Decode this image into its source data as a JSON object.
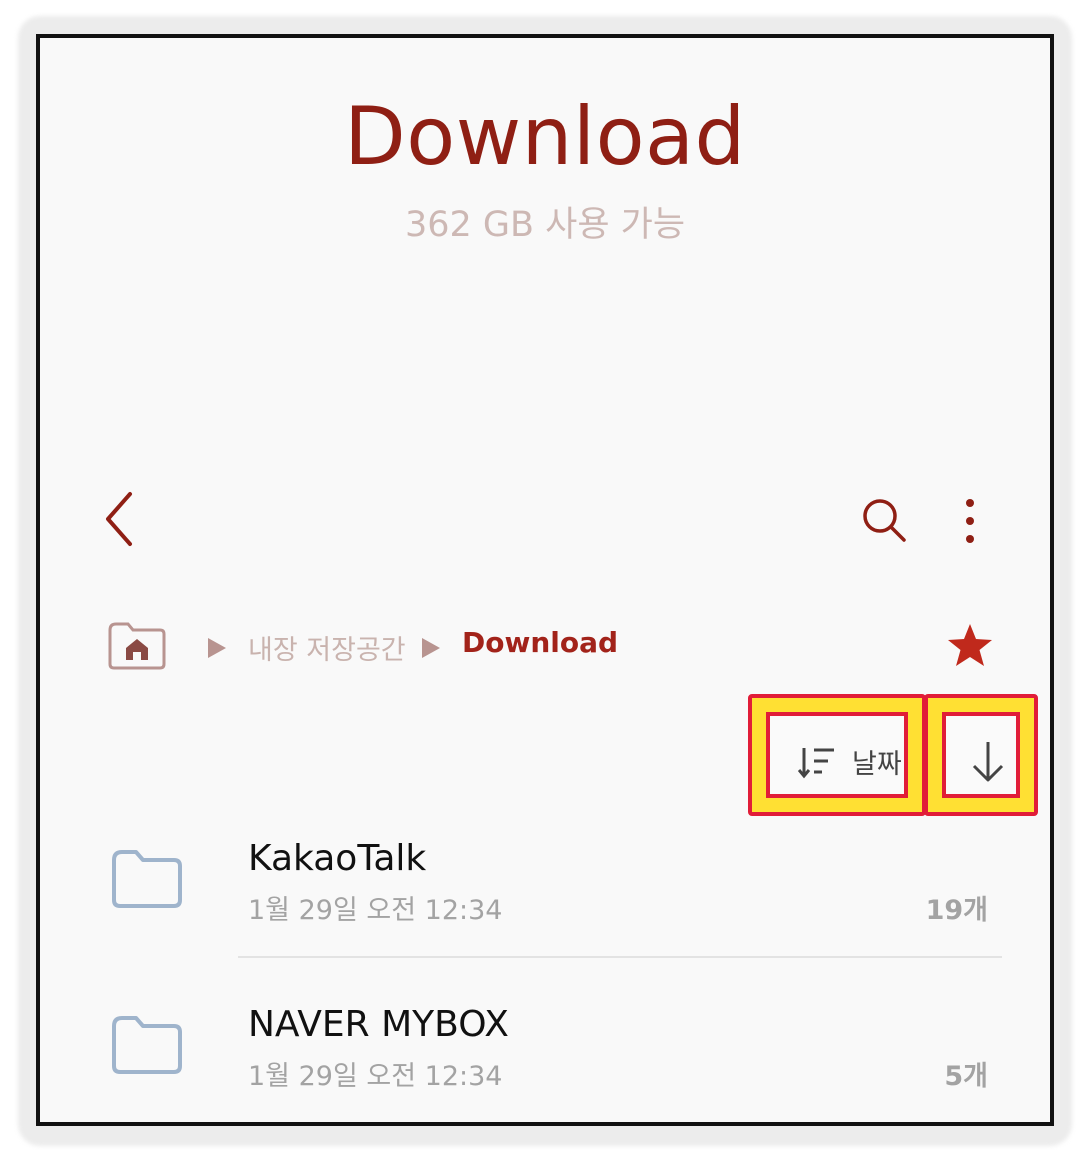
{
  "header": {
    "title": "Download",
    "storage_available": "362 GB 사용 가능"
  },
  "toolbar": {
    "back_icon": "chevron-left-icon",
    "search_icon": "search-icon",
    "more_icon": "more-vertical-icon"
  },
  "breadcrumb": {
    "home_icon": "home-icon",
    "items": [
      "내장 저장공간",
      "Download"
    ],
    "favorite_icon": "star-icon"
  },
  "sort": {
    "label": "날짜",
    "direction_icon": "arrow-down-icon"
  },
  "files": [
    {
      "name": "KakaoTalk",
      "date": "1월 29일 오전 12:34",
      "count": "19개"
    },
    {
      "name": "NAVER MYBOX",
      "date": "1월 29일 오전 12:34",
      "count": "5개"
    }
  ],
  "colors": {
    "accent": "#8f1f14",
    "subtitle": "#cdb8b4",
    "highlight_fill": "#ffe033",
    "highlight_border": "#e11d38",
    "folder": "#9fb4cc"
  }
}
